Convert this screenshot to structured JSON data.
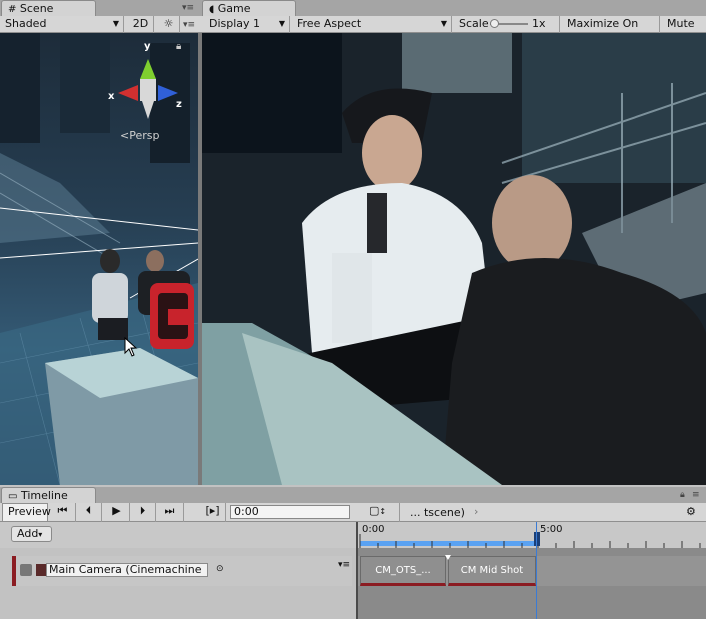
{
  "scene": {
    "tab_label": "Scene",
    "draw_mode": "Shaded",
    "toggle_2d": "2D",
    "gizmo": {
      "y": "y",
      "x": "x",
      "z": "z",
      "projection": "Persp"
    }
  },
  "game": {
    "tab_label": "Game",
    "display": "Display 1",
    "aspect": "Free Aspect",
    "scale_label": "Scale",
    "scale_value": "1x",
    "maximize": "Maximize On Play",
    "mute": "Mute Au"
  },
  "timeline": {
    "tab_label": "Timeline",
    "preview": "Preview",
    "time_field": "0:00",
    "breadcrumb": "... tscene)",
    "add_button": "Add",
    "ruler": {
      "start": "0:00",
      "mark": "5:00"
    },
    "track_name": "Main Camera (Cinemachine",
    "clips": [
      {
        "label": "CM_OTS_..."
      },
      {
        "label": "CM Mid Shot"
      }
    ]
  },
  "colors": {
    "accent_blue": "#3a7bd5",
    "clip_red": "#8b1c22",
    "gizmo_y": "#7fcf2f",
    "gizmo_x": "#d23030",
    "gizmo_z": "#3060d8"
  }
}
